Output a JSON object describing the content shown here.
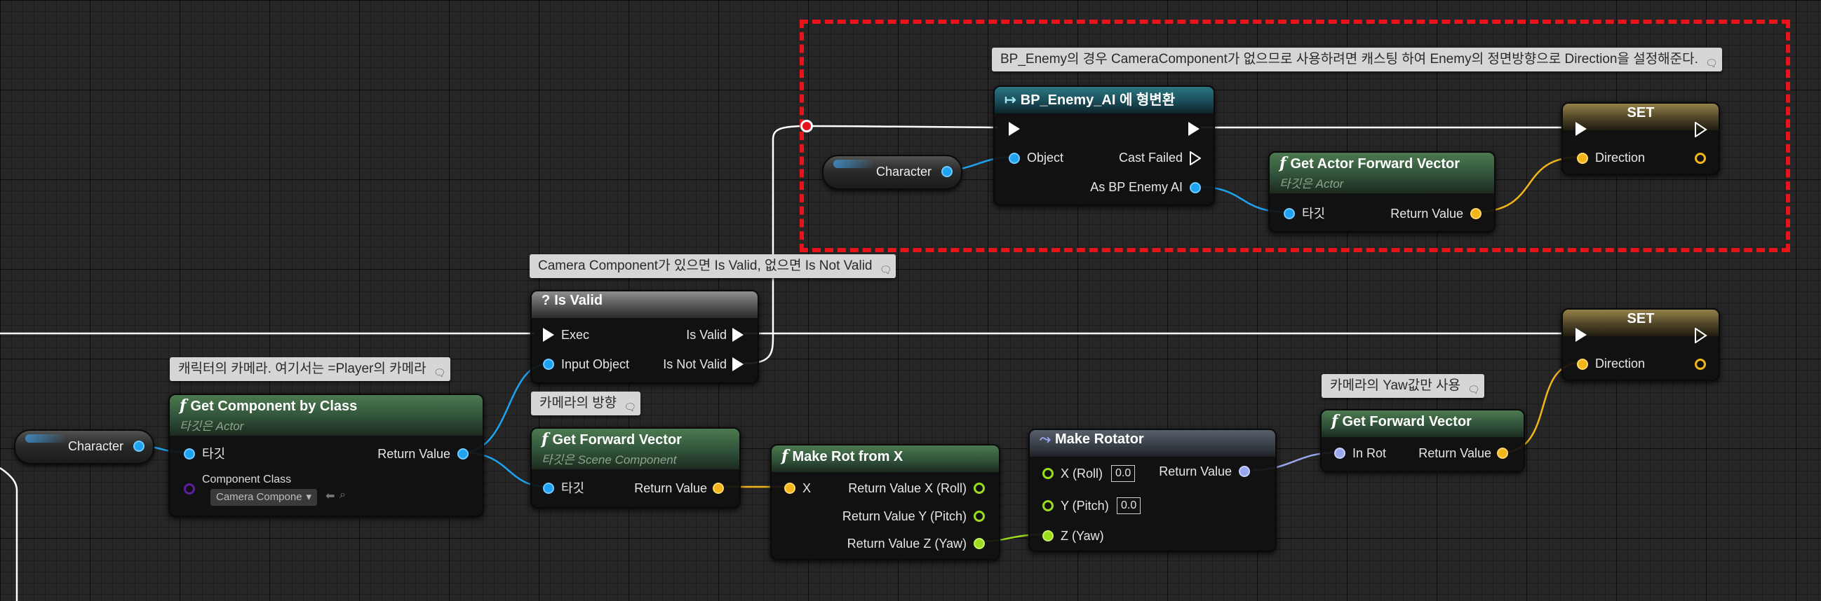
{
  "colors": {
    "background": "#262626",
    "selection": "#e8141c",
    "exec_wire": "#ffffff",
    "object_pin": "#1fa3f0",
    "vector_pin": "#f3b61a",
    "float_pin": "#9bdc1c",
    "rotator_pin": "#9aa7ef",
    "class_pin": "#5c1fa2"
  },
  "comments": {
    "top_note": "BP_Enemy의 경우 CameraComponent가 없으므로 사용하려면 캐스팅 하여 Enemy의 정면방향으로 Direction을 설정해준다.",
    "is_valid_note": "Camera Component가 있으면 Is Valid, 없으면 Is Not Valid",
    "camera_note": "캐릭터의 카메라. 여기서는 =Player의 카메라",
    "direction_note": "카메라의 방향",
    "yaw_note": "카메라의 Yaw값만 사용"
  },
  "cast_node": {
    "title": "BP_Enemy_AI 에 형변환",
    "object_pin": "Object",
    "cast_failed": "Cast Failed",
    "as_pin": "As BP Enemy AI"
  },
  "character_var_top": "Character",
  "character_var_bottom": "Character",
  "actor_forward": {
    "title": "Get Actor Forward Vector",
    "subtitle": "타깃은 Actor",
    "target": "타깃",
    "return": "Return Value"
  },
  "set_top": {
    "title": "SET",
    "direction": "Direction"
  },
  "set_bottom": {
    "title": "SET",
    "direction": "Direction"
  },
  "is_valid": {
    "title": "Is Valid",
    "exec": "Exec",
    "input_object": "Input Object",
    "is_valid": "Is Valid",
    "is_not_valid": "Is Not Valid"
  },
  "get_component": {
    "title": "Get Component by Class",
    "subtitle": "타깃은 Actor",
    "target": "타깃",
    "return": "Return Value",
    "component_class": "Component Class",
    "combo_value": "Camera Compone"
  },
  "forward_vector": {
    "title": "Get Forward Vector",
    "subtitle": "타깃은 Scene Component",
    "target": "타깃",
    "return": "Return Value"
  },
  "make_rot_from_x": {
    "title": "Make Rot from X",
    "x": "X",
    "roll": "Return Value X (Roll)",
    "pitch": "Return Value Y (Pitch)",
    "yaw": "Return Value Z (Yaw)"
  },
  "make_rotator": {
    "title": "Make Rotator",
    "x": "X (Roll)",
    "x_val": "0.0",
    "y": "Y (Pitch)",
    "y_val": "0.0",
    "z": "Z (Yaw)",
    "return": "Return Value"
  },
  "get_forward_vector2": {
    "title": "Get Forward Vector",
    "in_rot": "In Rot",
    "return": "Return Value"
  },
  "icons": {
    "function": "function-icon",
    "cast": "cast-icon",
    "macro": "question-icon",
    "rotator": "rotator-icon",
    "comment": "comment-bubble-icon",
    "reroute": "reroute-knot-icon"
  }
}
